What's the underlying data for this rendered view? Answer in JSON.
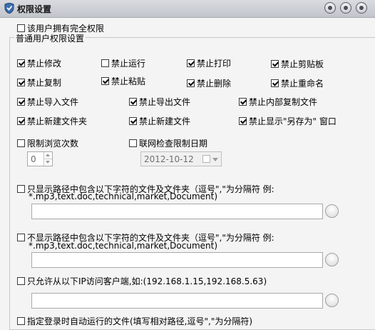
{
  "window": {
    "title": "权限设置"
  },
  "full_permission": {
    "label": "该用户拥有完全权限",
    "checked": false
  },
  "group": {
    "title": "普通用户权限设置",
    "perms": [
      {
        "label": "禁止修改",
        "checked": true
      },
      {
        "label": "禁止运行",
        "checked": false
      },
      {
        "label": "禁止打印",
        "checked": true
      },
      {
        "label": "禁止剪贴板",
        "checked": true
      },
      {
        "label": "禁止复制",
        "checked": true
      },
      {
        "label": "禁止粘贴",
        "checked": true
      },
      {
        "label": "禁止删除",
        "checked": true
      },
      {
        "label": "禁止重命名",
        "checked": true
      },
      {
        "label": "禁止导入文件",
        "checked": true
      },
      {
        "label": "禁止导出文件",
        "checked": true
      },
      {
        "label": "禁止内部复制文件",
        "checked": true
      },
      {
        "label": "禁止新建文件夹",
        "checked": true
      },
      {
        "label": "禁止新建文件",
        "checked": true
      },
      {
        "label": "禁止显示\"另存为\" 窗口",
        "checked": true
      }
    ],
    "limit_views": {
      "label": "限制浏览次数",
      "checked": false,
      "value": "0"
    },
    "online_date": {
      "label": "联网检查限制日期",
      "checked": false,
      "value": "2012-10-12"
    },
    "only_show": {
      "label": "只显示路径中包含以下字符的文件及文件夹（逗号\",\"为分隔符 例:",
      "example": "*.mp3,text.doc,technical,market,Document)",
      "value": "",
      "checked": false
    },
    "not_show": {
      "label": "不显示路径中包含以下字符的文件及文件夹（逗号\",\"为分隔符 例:",
      "example": "*.mp3,text.doc,technical,market,Document)",
      "value": "",
      "checked": false
    },
    "ip_allow": {
      "label": "只允许从以下IP访问客户端,如:(192.168.1.15,192.168.5.63)",
      "value": "",
      "checked": false
    },
    "autorun": {
      "label": "指定登录时自动运行的文件(填写相对路径,逗号\",\"为分隔符)",
      "checked": false
    }
  }
}
